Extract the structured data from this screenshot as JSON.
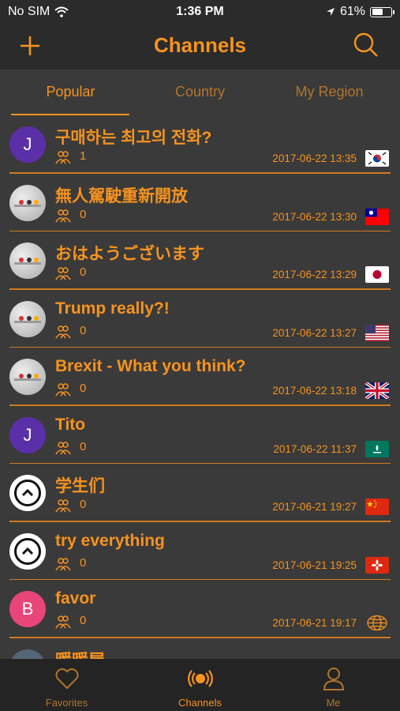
{
  "status": {
    "carrier": "No SIM",
    "time": "1:36 PM",
    "battery": "61%",
    "battery_level": 0.61
  },
  "nav": {
    "title": "Channels",
    "add_icon": "plus-icon",
    "search_icon": "search-icon"
  },
  "tabs": [
    {
      "label": "Popular",
      "active": true
    },
    {
      "label": "Country",
      "active": false
    },
    {
      "label": "My Region",
      "active": false
    }
  ],
  "channels": [
    {
      "title": "구매하는 최고의 전화?",
      "count": "1",
      "date": "2017-06-22 13:35",
      "avatar_letter": "J",
      "flag": "south-korea"
    },
    {
      "title": "無人駕駛重新開放",
      "count": "0",
      "date": "2017-06-22 13:30",
      "flag": "taiwan"
    },
    {
      "title": "おはようございます",
      "count": "0",
      "date": "2017-06-22 13:29",
      "flag": "japan"
    },
    {
      "title": "Trump really?!",
      "count": "0",
      "date": "2017-06-22 13:27",
      "flag": "usa"
    },
    {
      "title": "Brexit - What you think?",
      "count": "0",
      "date": "2017-06-22 13:18",
      "flag": "uk"
    },
    {
      "title": "Tito",
      "count": "0",
      "date": "2017-06-22 11:37",
      "avatar_letter": "J",
      "flag": "macau"
    },
    {
      "title": "学生们",
      "count": "0",
      "date": "2017-06-21 19:27",
      "flag": "china"
    },
    {
      "title": "try everything",
      "count": "0",
      "date": "2017-06-21 19:25",
      "flag": "hong-kong"
    },
    {
      "title": "favor",
      "count": "0",
      "date": "2017-06-21 19:17",
      "avatar_letter": "B",
      "flag": "globe"
    },
    {
      "title": "暖暖屋",
      "count": "",
      "date": "",
      "flag": ""
    }
  ],
  "tabbar": [
    {
      "label": "Favorites",
      "icon": "heart-icon"
    },
    {
      "label": "Channels",
      "icon": "broadcast-icon"
    },
    {
      "label": "Me",
      "icon": "person-icon"
    }
  ],
  "colors": {
    "accent": "#f7931e",
    "background": "#3a3a3a",
    "bar": "#2b2b2b"
  }
}
